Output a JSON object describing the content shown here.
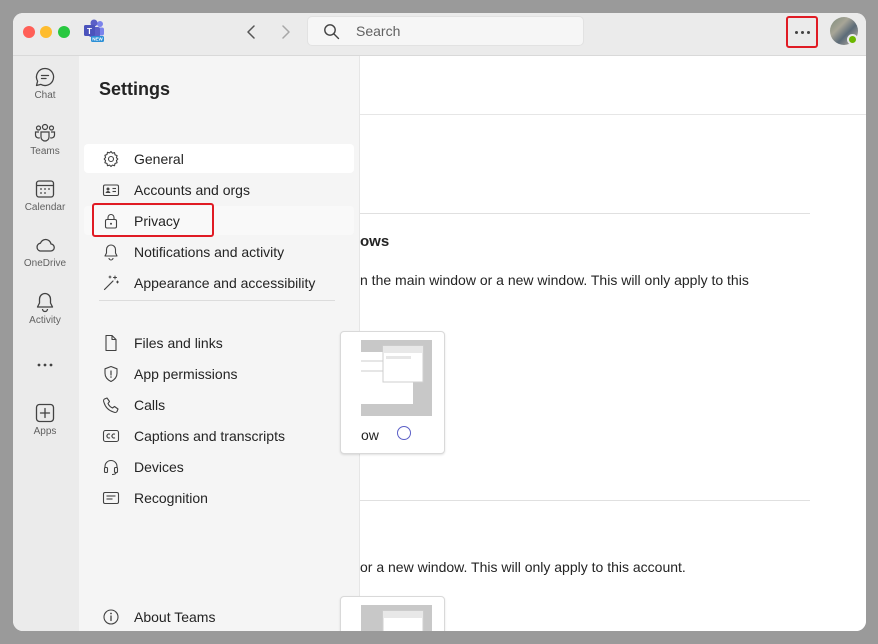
{
  "search": {
    "placeholder": "Search"
  },
  "rail": [
    {
      "label": "Chat",
      "icon": "chat-icon"
    },
    {
      "label": "Teams",
      "icon": "teams-icon"
    },
    {
      "label": "Calendar",
      "icon": "calendar-icon"
    },
    {
      "label": "OneDrive",
      "icon": "cloud-icon"
    },
    {
      "label": "Activity",
      "icon": "bell-icon"
    },
    {
      "label": "",
      "icon": "more-horizontal-icon"
    },
    {
      "label": "Apps",
      "icon": "add-app-icon"
    }
  ],
  "settings": {
    "title": "Settings",
    "items": [
      {
        "label": "General",
        "icon": "gear-icon"
      },
      {
        "label": "Accounts and orgs",
        "icon": "id-card-icon"
      },
      {
        "label": "Privacy",
        "icon": "lock-icon"
      },
      {
        "label": "Notifications and activity",
        "icon": "bell-icon"
      },
      {
        "label": "Appearance and accessibility",
        "icon": "magic-wand-icon"
      },
      {
        "label": "Files and links",
        "icon": "file-icon"
      },
      {
        "label": "App permissions",
        "icon": "shield-icon"
      },
      {
        "label": "Calls",
        "icon": "phone-icon"
      },
      {
        "label": "Captions and transcripts",
        "icon": "closed-captions-icon"
      },
      {
        "label": "Devices",
        "icon": "headset-icon"
      },
      {
        "label": "Recognition",
        "icon": "recognition-icon"
      }
    ],
    "about": {
      "label": "About Teams",
      "icon": "info-icon"
    }
  },
  "content": {
    "heading_fragment": "ows",
    "text1_fragment": "n the main window or a new window. This will only apply to this",
    "card1_label_fragment": "ow",
    "text2_fragment": "or a new window. This will only apply to this account."
  },
  "colors": {
    "accent": "#5b5fc7",
    "highlight": "#e01b24",
    "presence": "#6bb700"
  }
}
